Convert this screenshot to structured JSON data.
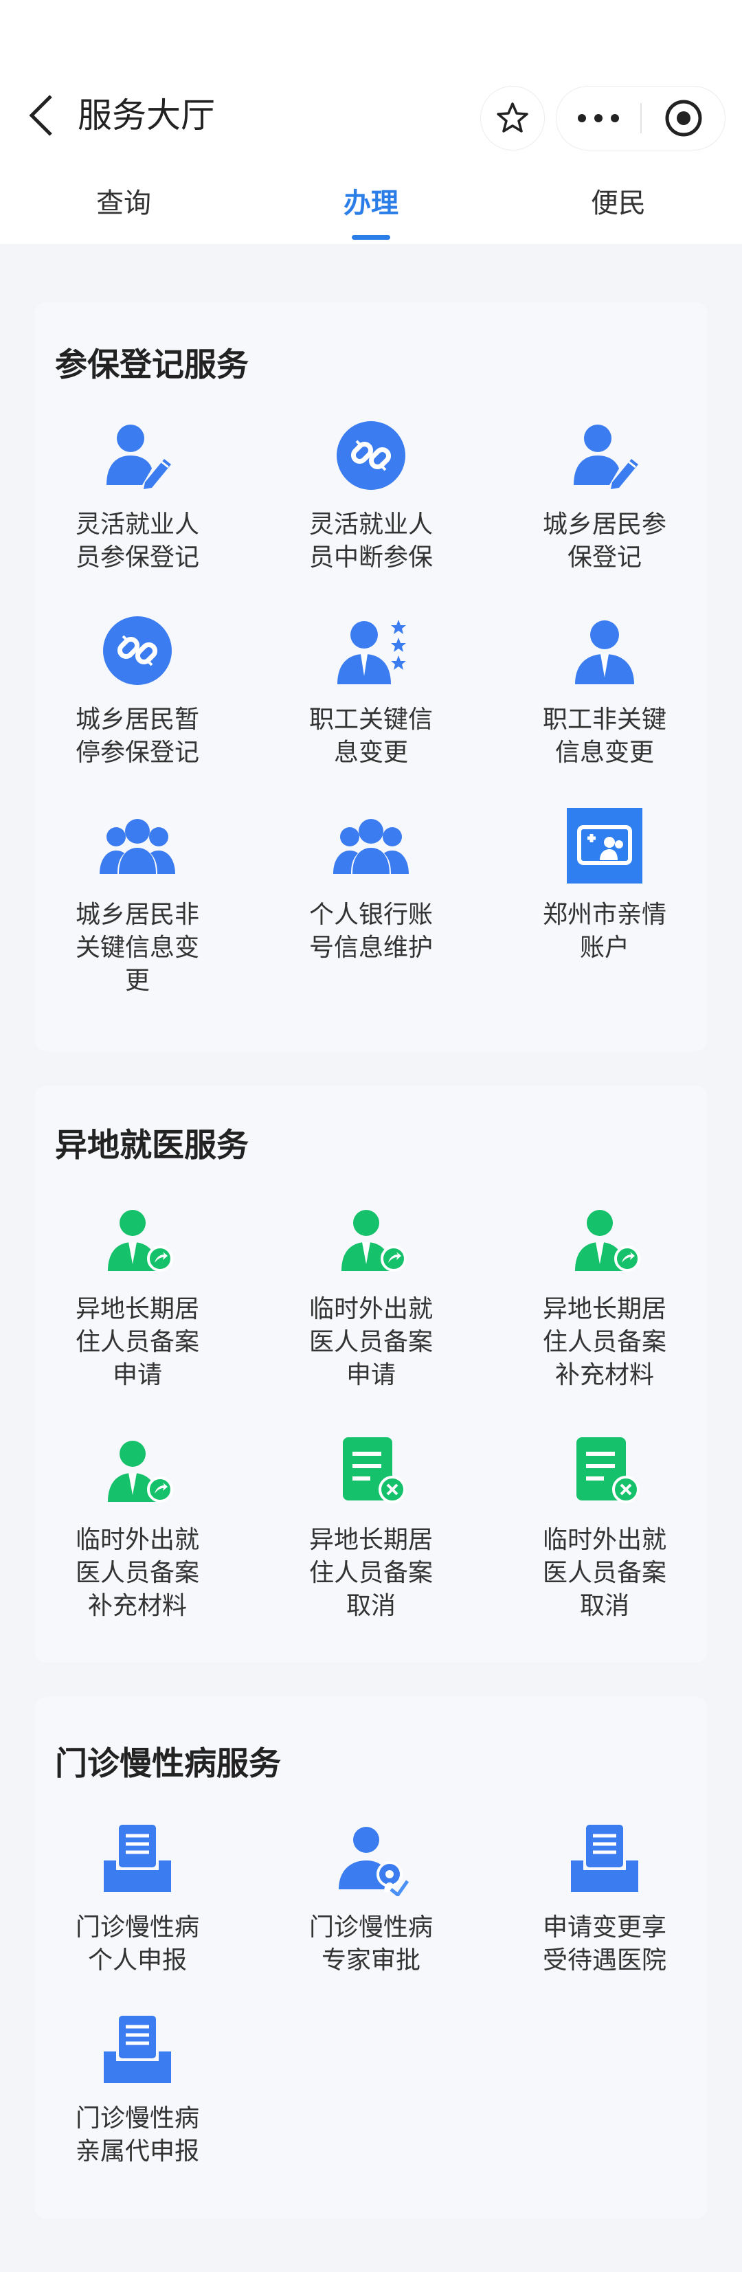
{
  "header": {
    "title": "服务大厅"
  },
  "tabs": [
    {
      "label": "查询"
    },
    {
      "label": "办理"
    },
    {
      "label": "便民"
    }
  ],
  "colors": {
    "accent": "#2b7de8",
    "icon_blue": "#3b7df0",
    "icon_green": "#15c16a"
  },
  "sections": [
    {
      "title": "参保登记服务",
      "items": [
        {
          "label": "灵活就业人员参保登记",
          "icon": "person-edit-icon"
        },
        {
          "label": "灵活就业人员中断参保",
          "icon": "broken-link-icon"
        },
        {
          "label": "城乡居民参保登记",
          "icon": "person-edit-icon"
        },
        {
          "label": "城乡居民暂停参保登记",
          "icon": "broken-link-icon"
        },
        {
          "label": "职工关键信息变更",
          "icon": "person-star-icon"
        },
        {
          "label": "职工非关键信息变更",
          "icon": "person-tie-icon"
        },
        {
          "label": "城乡居民非关键信息变更",
          "icon": "group-icon"
        },
        {
          "label": "个人银行账号信息维护",
          "icon": "group-icon"
        },
        {
          "label": "郑州市亲情账户",
          "icon": "family-account-icon"
        }
      ]
    },
    {
      "title": "异地就医服务",
      "items": [
        {
          "label": "异地长期居住人员备案申请",
          "icon": "doctor-share-icon"
        },
        {
          "label": "临时外出就医人员备案申请",
          "icon": "doctor-share-icon"
        },
        {
          "label": "异地长期居住人员备案补充材料",
          "icon": "doctor-share-icon"
        },
        {
          "label": "临时外出就医人员备案补充材料",
          "icon": "doctor-share-icon"
        },
        {
          "label": "异地长期居住人员备案取消",
          "icon": "document-cancel-icon"
        },
        {
          "label": "临时外出就医人员备案取消",
          "icon": "document-cancel-icon"
        }
      ]
    },
    {
      "title": "门诊慢性病服务",
      "items": [
        {
          "label": "门诊慢性病个人申报",
          "icon": "tray-document-icon"
        },
        {
          "label": "门诊慢性病专家审批",
          "icon": "expert-approve-icon"
        },
        {
          "label": "申请变更享受待遇医院",
          "icon": "tray-document-icon"
        },
        {
          "label": "门诊慢性病亲属代申报",
          "icon": "tray-document-icon"
        }
      ]
    }
  ]
}
